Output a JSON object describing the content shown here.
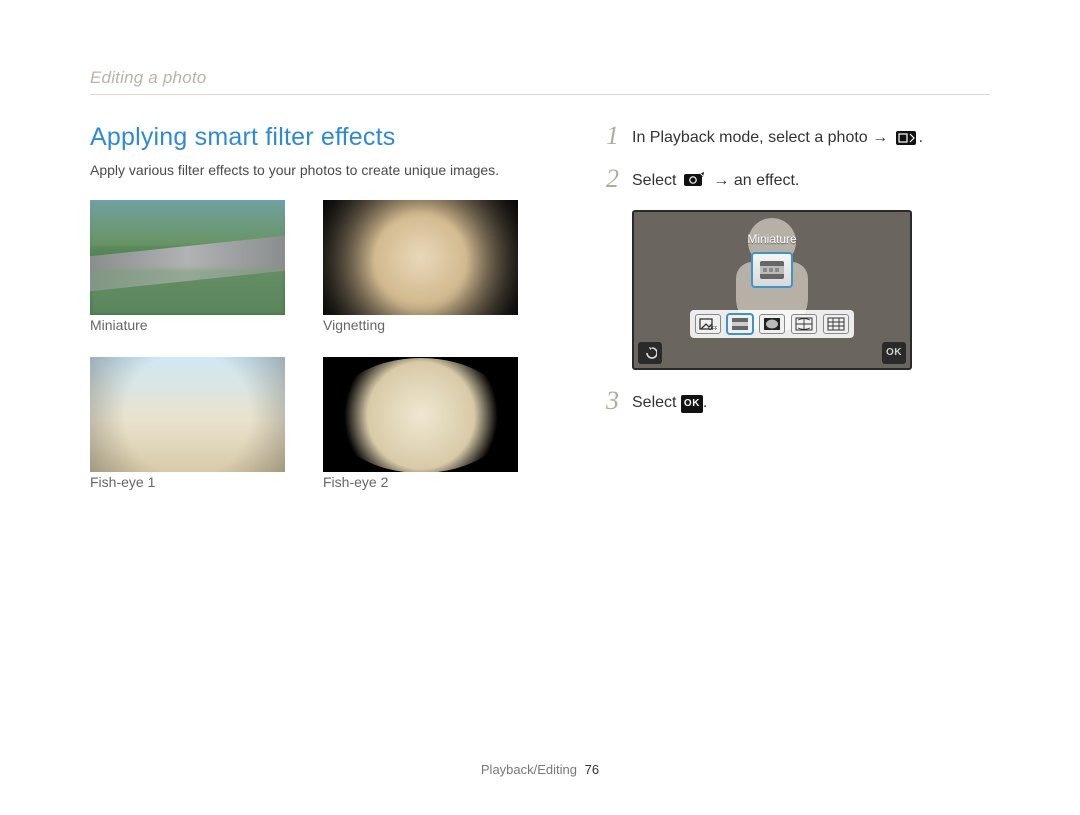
{
  "breadcrumb": "Editing a photo",
  "section": {
    "title": "Applying smart filter effects",
    "description": "Apply various filter effects to your photos to create unique images."
  },
  "thumbnails": [
    {
      "caption": "Miniature"
    },
    {
      "caption": "Vignetting"
    },
    {
      "caption": "Fish-eye 1"
    },
    {
      "caption": "Fish-eye 2"
    }
  ],
  "steps": {
    "s1": {
      "num": "1",
      "pre": "In Playback mode, select a photo →",
      "post": "."
    },
    "s2": {
      "num": "2",
      "pre": "Select",
      "mid": "→ an effect."
    },
    "s3": {
      "num": "3",
      "pre": "Select",
      "post": "."
    }
  },
  "device": {
    "label": "Miniature",
    "ok": "OK"
  },
  "okText": "OK",
  "footer": {
    "section": "Playback/Editing",
    "page": "76"
  }
}
